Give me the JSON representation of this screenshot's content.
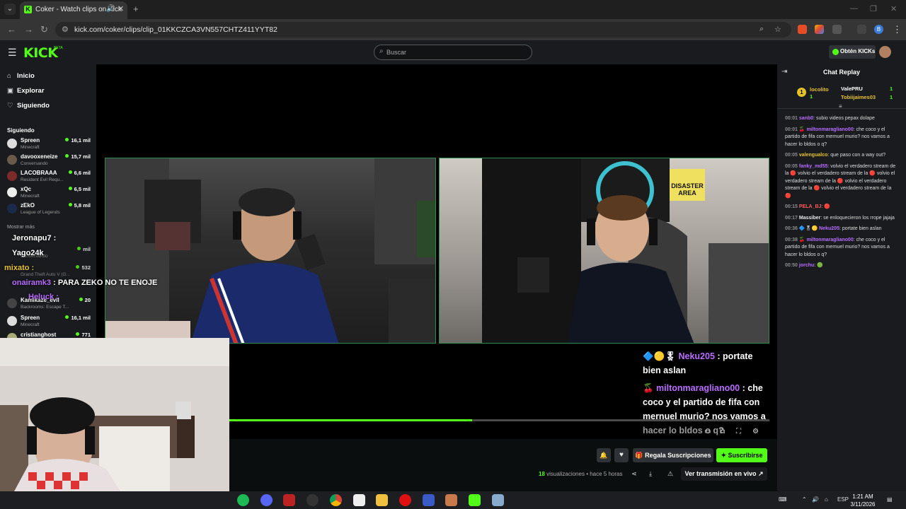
{
  "browser": {
    "tab_title": "Coker - Watch clips on Kick",
    "url": "kick.com/coker/clips/clip_01KKCZCA3VN557CHTZ411YYT82",
    "profile_initial": "B"
  },
  "header": {
    "logo": "KICK",
    "beta": "BETA",
    "search_placeholder": "Buscar",
    "kicks_label": "Obtén KICKs"
  },
  "sidebar": {
    "nav": [
      {
        "label": "Inicio",
        "icon": "home-icon"
      },
      {
        "label": "Explorar",
        "icon": "compass-icon"
      },
      {
        "label": "Siguiendo",
        "icon": "heart-icon"
      }
    ],
    "following_title": "Siguiendo",
    "channels": [
      {
        "name": "Spreen",
        "game": "Minecraft",
        "viewers": "16,1 mil"
      },
      {
        "name": "davooxeneize",
        "game": "Conversando",
        "viewers": "15,7 mil"
      },
      {
        "name": "LACOBRAAA",
        "game": "Resident Evil Requ...",
        "viewers": "6,6 mil"
      },
      {
        "name": "xQc",
        "game": "Minecraft",
        "viewers": "6,5 mil"
      },
      {
        "name": "zEkO",
        "game": "League of Legends",
        "viewers": "5,8 mil"
      }
    ],
    "show_more": "Mostrar más",
    "channels2": [
      {
        "name": "Spreen",
        "game": "Minecraft",
        "viewers": "16,1 mil"
      },
      {
        "name": "cristianghost",
        "game": "",
        "viewers": "771"
      }
    ],
    "overlay_partial": [
      {
        "name": "Kamikaze_evil",
        "game": "Backrooms: Escape T...",
        "viewers": "20"
      },
      {
        "name": "",
        "game": "Grand Theft Auto V (G...",
        "viewers": "532"
      },
      {
        "name": "",
        "game": "Conversando",
        "viewers": "mil"
      }
    ]
  },
  "video": {
    "overlay_chat": {
      "line1_user": "Neku205",
      "line1_text": ": portate",
      "line2": "bien aslan",
      "line3_user": "miltonmaragliano00",
      "line3_text": ": che",
      "line4": "coco y el partido de fifa con",
      "line5": "mernuel murio? nos vamos a",
      "line6": "hacer lo bldos o q?"
    },
    "left_overlay": {
      "n1": "Jeronapu7 :",
      "n2": "Yago24k",
      "n3": "mixato :",
      "n4_user": "onairamk3",
      "n4_text": ": PARA ZEKO NO TE ENOJE",
      "n5": "Heluck :"
    },
    "progress_fraction": 0.45
  },
  "actions": {
    "gift_label": "Regala Suscripciones",
    "subscribe_label": "Suscribirse",
    "views_count": "18",
    "views_text": "visualizaciones",
    "time_ago": "• hace 5 horas",
    "watch_live": "Ver transmisión en vivo"
  },
  "chat": {
    "title": "Chat Replay",
    "gifters": [
      {
        "name": "locolito",
        "count": "1"
      },
      {
        "name": "ValePRU",
        "count": "1"
      },
      {
        "name": "Tobiijaimes03",
        "count": "1"
      }
    ],
    "messages": [
      {
        "time": "00:01",
        "user": "sanb0",
        "color": "#b96cff",
        "text": ": subio videos pepax dolape"
      },
      {
        "time": "00:01",
        "user": "miltonmaragliano00",
        "color": "#b96cff",
        "text": ": che coco y el partido de fifa con mernuel murio? nos vamos a hacer lo bldos o q?"
      },
      {
        "time": "00:05",
        "user": "valengualco",
        "color": "#e6c229",
        "text": ": que paso con a way out?"
      },
      {
        "time": "00:05",
        "user": "fanky_md55",
        "color": "#b96cff",
        "text": ": volvio el verdadero stream de la 🔴 volvio el verdadero stream de la 🔴 volvio el verdadero stream de la 🔴 volvio el verdadero stream de la 🔴 volvio el verdadero stream de la 🔴"
      },
      {
        "time": "00:15",
        "user": "PELA_BJ",
        "color": "#ff5b5b",
        "text": ": 🔴"
      },
      {
        "time": "00:17",
        "user": "Massiber",
        "color": "#e7e9ea",
        "text": ": se enloquecieron los rrope jajaja"
      },
      {
        "time": "00:36",
        "user": "Neku205",
        "color": "#b96cff",
        "text": ": portate bien aslan"
      },
      {
        "time": "00:38",
        "user": "miltonmaragliano00",
        "color": "#b96cff",
        "text": ": che coco y el partido de fifa con mernuel murio? nos vamos a hacer lo bldos o q?"
      },
      {
        "time": "00:50",
        "user": "jorchu",
        "color": "#b96cff",
        "text": ": 🟢"
      }
    ]
  },
  "taskbar": {
    "lang": "ESP",
    "time": "1:21 AM",
    "date": "3/11/2026"
  }
}
